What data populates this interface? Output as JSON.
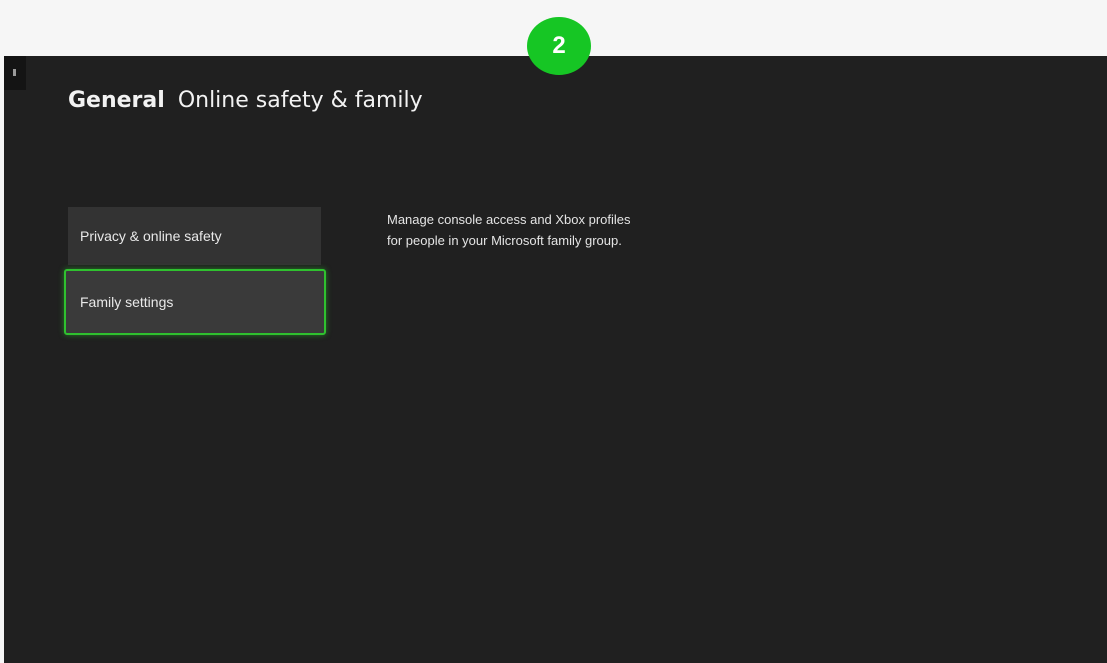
{
  "step_badge": "2",
  "header": {
    "section": "General",
    "page": "Online safety & family"
  },
  "menu": {
    "items": [
      {
        "label": "Privacy & online safety",
        "selected": false
      },
      {
        "label": "Family settings",
        "selected": true
      }
    ]
  },
  "description": "Manage console access and Xbox profiles for people in your Microsoft family group.",
  "colors": {
    "background": "#202020",
    "accent": "#2fc12f",
    "badge": "#16c624"
  }
}
